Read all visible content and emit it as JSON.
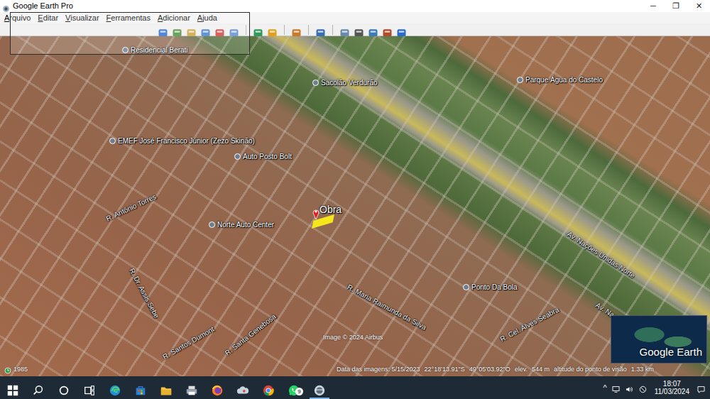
{
  "window": {
    "title": "Google Earth Pro",
    "controls": [
      "─",
      "❐",
      "✕"
    ]
  },
  "menu": [
    "Arquivo",
    "Editar",
    "Visualizar",
    "Ferramentas",
    "Adicionar",
    "Ajuda"
  ],
  "map": {
    "labels": [
      {
        "text": "Residencial Berati",
        "kind": "place"
      },
      {
        "text": "Sacolão Verdurão",
        "kind": "place"
      },
      {
        "text": "Parque Água do Castelo",
        "kind": "place"
      },
      {
        "text": "EMEF José Francisco Júnior (Zezo Skinão)",
        "kind": "place"
      },
      {
        "text": "Auto Posto Bolt",
        "kind": "place"
      },
      {
        "text": "Obra",
        "kind": "marker"
      },
      {
        "text": "Norte Auto Center",
        "kind": "place"
      },
      {
        "text": "Ponto Da Bola",
        "kind": "place"
      },
      {
        "text": "Av. Nações Unidas Norte",
        "kind": "street"
      },
      {
        "text": "Av. Nações Unidas",
        "kind": "street"
      },
      {
        "text": "R. Antônio Torres",
        "kind": "street"
      },
      {
        "text": "R. Dr. Assis Sebe",
        "kind": "street"
      },
      {
        "text": "R. Maria Raimunda da Silva",
        "kind": "street"
      },
      {
        "text": "R. Cel. Alves Seabra",
        "kind": "street"
      },
      {
        "text": "R. Santos Dumont",
        "kind": "street"
      },
      {
        "text": "R. Santa Genebosa",
        "kind": "street"
      }
    ],
    "year": "1985",
    "credit": "Image © 2024 Airbus",
    "status": {
      "date": "Data das imagens: 5/15/2023",
      "lat": "22°18'13.91\"S",
      "lon": "49°05'03.92\"O",
      "elev_label": "elev.",
      "elev": "544 m",
      "eye_label": "altitude do ponto de visão",
      "eye": "1.33 km"
    },
    "logo": "Google Earth"
  },
  "taskbar": {
    "apps": [
      {
        "kind": "start",
        "running": false
      },
      {
        "kind": "search",
        "running": false
      },
      {
        "kind": "cortana",
        "running": false
      },
      {
        "kind": "taskview",
        "running": false
      },
      {
        "kind": "edge",
        "running": false
      },
      {
        "kind": "store",
        "running": false
      },
      {
        "kind": "explorer",
        "running": false
      },
      {
        "kind": "printer",
        "running": false
      },
      {
        "kind": "firefox",
        "running": false
      },
      {
        "kind": "cloud",
        "running": false
      },
      {
        "kind": "chrome",
        "running": false
      },
      {
        "kind": "whatsapp",
        "running": false,
        "badge": "9"
      },
      {
        "kind": "earth",
        "running": true
      }
    ],
    "tray": {
      "chevron": "^",
      "icons": [
        {
          "kind": "network"
        },
        {
          "kind": "volume"
        },
        {
          "kind": "keyboard"
        }
      ],
      "time": "18:07",
      "date": "11/03/2024",
      "notify": {
        "kind": "notification"
      }
    }
  }
}
